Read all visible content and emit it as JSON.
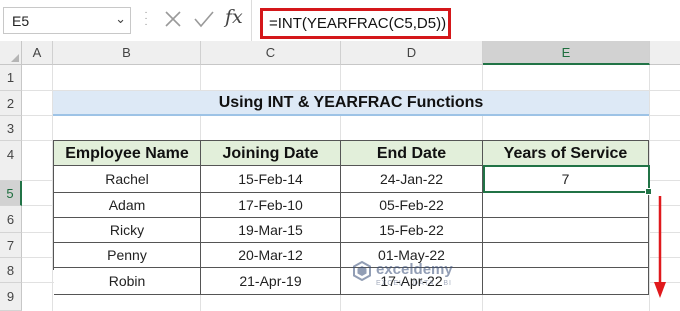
{
  "namebox": {
    "value": "E5"
  },
  "formula_bar": {
    "formula": "=INT(YEARFRAC(C5,D5))",
    "fx_label": "fx"
  },
  "columns": [
    "A",
    "B",
    "C",
    "D",
    "E"
  ],
  "selected_column": "E",
  "rows": [
    "1",
    "2",
    "3",
    "4",
    "5",
    "6",
    "7",
    "8",
    "9"
  ],
  "selected_row": "5",
  "title": "Using INT & YEARFRAC Functions",
  "table": {
    "headers": [
      "Employee Name",
      "Joining Date",
      "End Date",
      "Years of Service"
    ],
    "rows": [
      [
        "Rachel",
        "15-Feb-14",
        "24-Jan-22",
        "7"
      ],
      [
        "Adam",
        "17-Feb-10",
        "05-Feb-22",
        ""
      ],
      [
        "Ricky",
        "19-Mar-15",
        "15-Feb-22",
        ""
      ],
      [
        "Penny",
        "20-Mar-12",
        "01-May-22",
        ""
      ],
      [
        "Robin",
        "21-Apr-19",
        "17-Apr-22",
        ""
      ]
    ]
  },
  "watermark": {
    "name": "exceldemy",
    "tagline": "EXCEL · DATA · BI"
  },
  "colors": {
    "accent_green": "#217346",
    "formula_highlight": "#d4171a",
    "arrow_red": "#e0191c",
    "title_fill": "#dde9f6",
    "header_fill": "#e2efda"
  }
}
